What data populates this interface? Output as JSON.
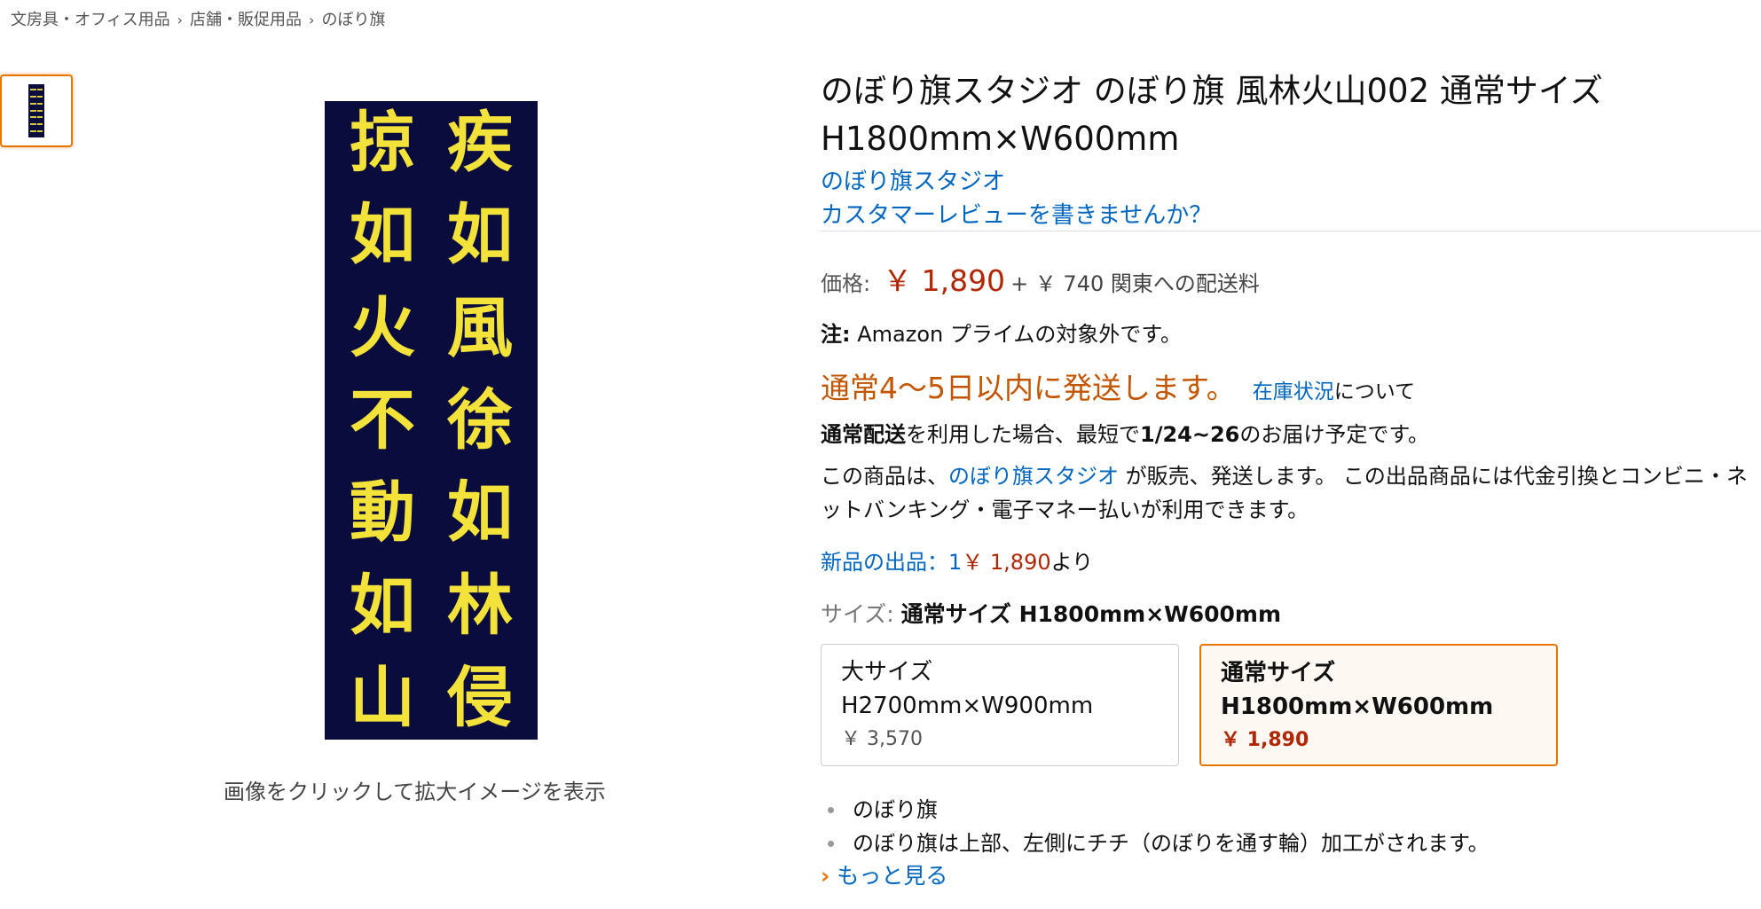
{
  "breadcrumb": [
    "文房具・オフィス用品",
    "店舗・販促用品",
    "のぼり旗"
  ],
  "breadcrumb_separator": "›",
  "image": {
    "caption": "画像をクリックして拡大イメージを表示",
    "columns": [
      [
        "疾",
        "如",
        "風",
        "徐",
        "如",
        "林",
        "侵"
      ],
      [
        "掠",
        "如",
        "火",
        "不",
        "動",
        "如",
        "山"
      ]
    ]
  },
  "product": {
    "title": "のぼり旗スタジオ のぼり旗 風林火山002 通常サイズ H1800mm×W600mm",
    "brand": "のぼり旗スタジオ",
    "review_link": "カスタマーレビューを書きませんか？",
    "price_label": "価格:",
    "price": "￥ 1,890",
    "shipping": "+ ￥ 740 関東への配送料",
    "note_label": "注:",
    "note_text": " Amazon プライムの対象外です。",
    "ship_status": "通常4～5日以内に発送します。",
    "stock_link": "在庫状況",
    "stock_suffix": "について",
    "delivery_bold": "通常配送",
    "delivery_mid": "を利用した場合、最短で",
    "delivery_date": "1/24~26",
    "delivery_end": "のお届け予定です。",
    "sold_prefix": "この商品は、",
    "sold_seller": "のぼり旗スタジオ",
    "sold_suffix": " が販売、発送します。 この出品商品には代金引換とコンビニ・ネットバンキング・電子マネー払いが利用できます。",
    "offers_link": "新品の出品：1",
    "offers_price": "￥ 1,890",
    "offers_suffix": "より",
    "size_label": "サイズ:",
    "size_selected": "通常サイズ H1800mm×W600mm",
    "size_options": [
      {
        "line1": "大サイズ",
        "line2": "H2700mm×W900mm",
        "price": "￥ 3,570"
      },
      {
        "line1": "通常サイズ",
        "line2": "H1800mm×W600mm",
        "price": "￥ 1,890"
      }
    ],
    "bullets": [
      "のぼり旗",
      "のぼり旗は上部、左側にチチ（のぼりを通す輪）加工がされます。"
    ],
    "more_link": "もっと見る"
  },
  "colors": {
    "link": "#0066c0",
    "price": "#b12704",
    "ship_status": "#c45500",
    "selected_border": "#e77600",
    "banner_bg": "#0a0c3e",
    "banner_text": "#f3e23a"
  },
  "icons": [
    "chevron-right-icon",
    "bullet-dot-icon"
  ]
}
